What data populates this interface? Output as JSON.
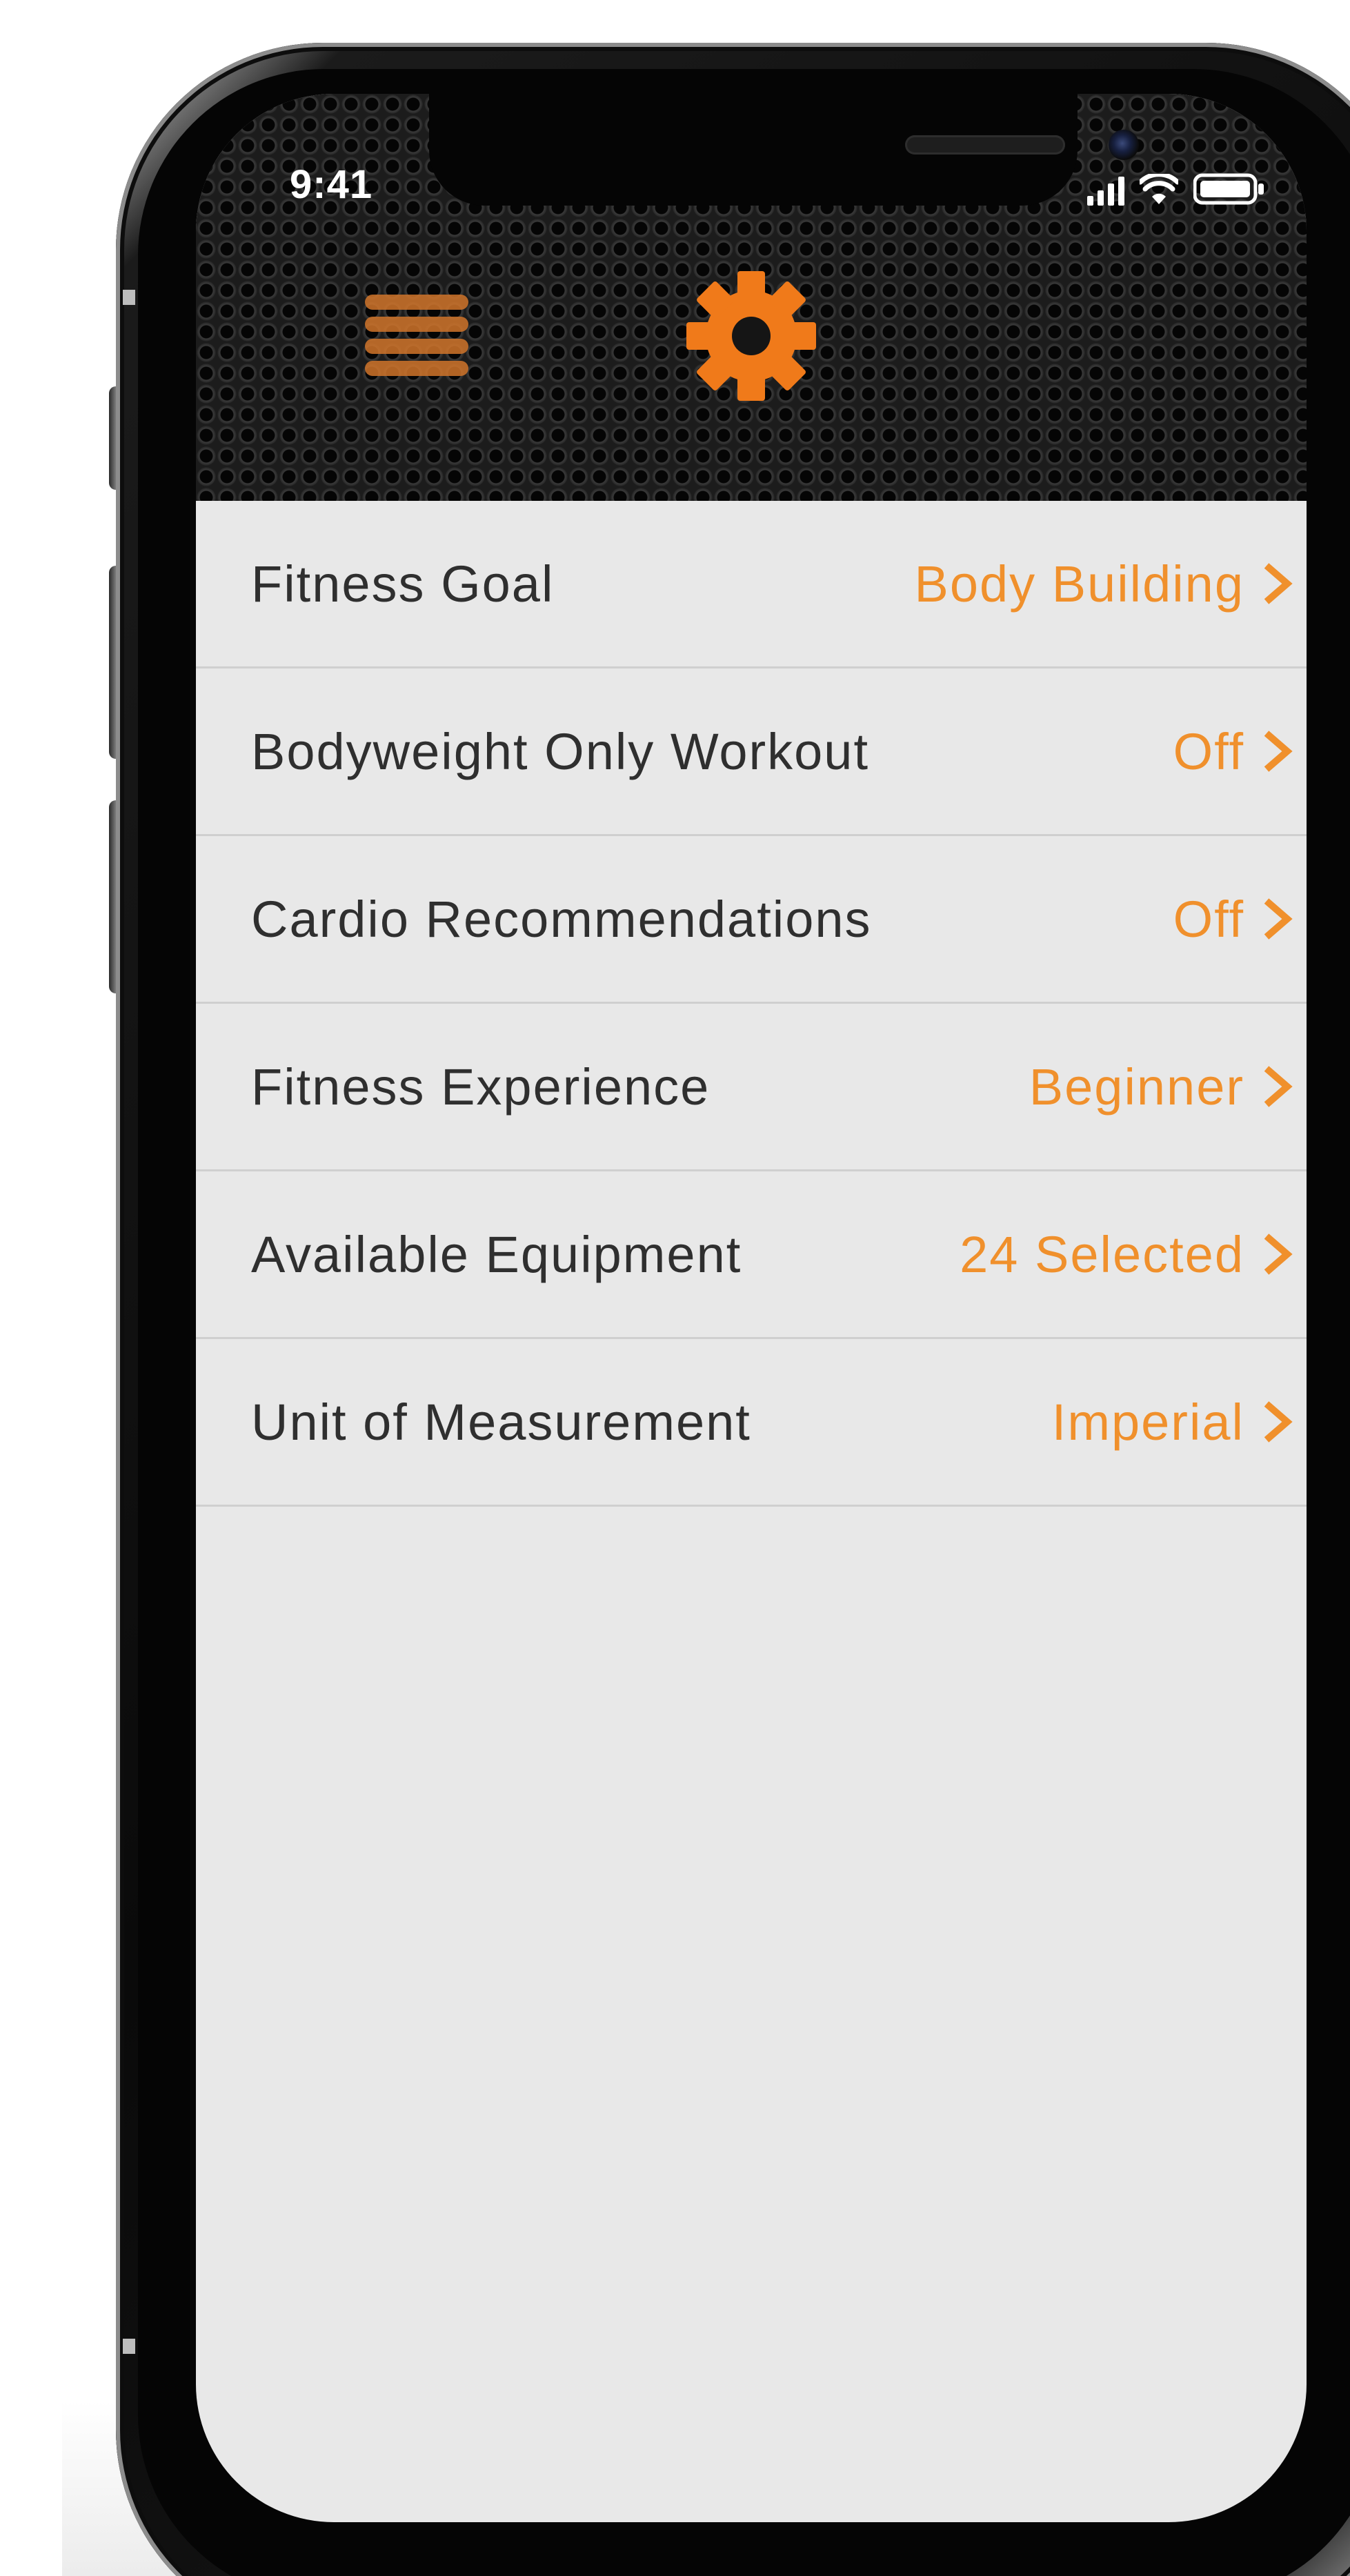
{
  "status_bar": {
    "time": "9:41",
    "icons": [
      "signal-icon",
      "wifi-icon",
      "battery-icon"
    ]
  },
  "header": {
    "menu_icon": "hamburger-menu-icon",
    "title_icon": "gear-icon"
  },
  "settings": {
    "items": [
      {
        "label": "Fitness Goal",
        "value": "Body Building"
      },
      {
        "label": "Bodyweight Only Workout",
        "value": "Off"
      },
      {
        "label": "Cardio Recommendations",
        "value": "Off"
      },
      {
        "label": "Fitness Experience",
        "value": "Beginner"
      },
      {
        "label": "Available Equipment",
        "value": "24 Selected"
      },
      {
        "label": "Unit of Measurement",
        "value": "Imperial"
      }
    ]
  },
  "colors": {
    "accent": "#f0902c",
    "menu_icon": "#d0742a",
    "label_text": "#2f2f2f",
    "list_background": "#e8e8e8",
    "divider": "#cfcfcf",
    "header_background": "#1c1c1c"
  }
}
